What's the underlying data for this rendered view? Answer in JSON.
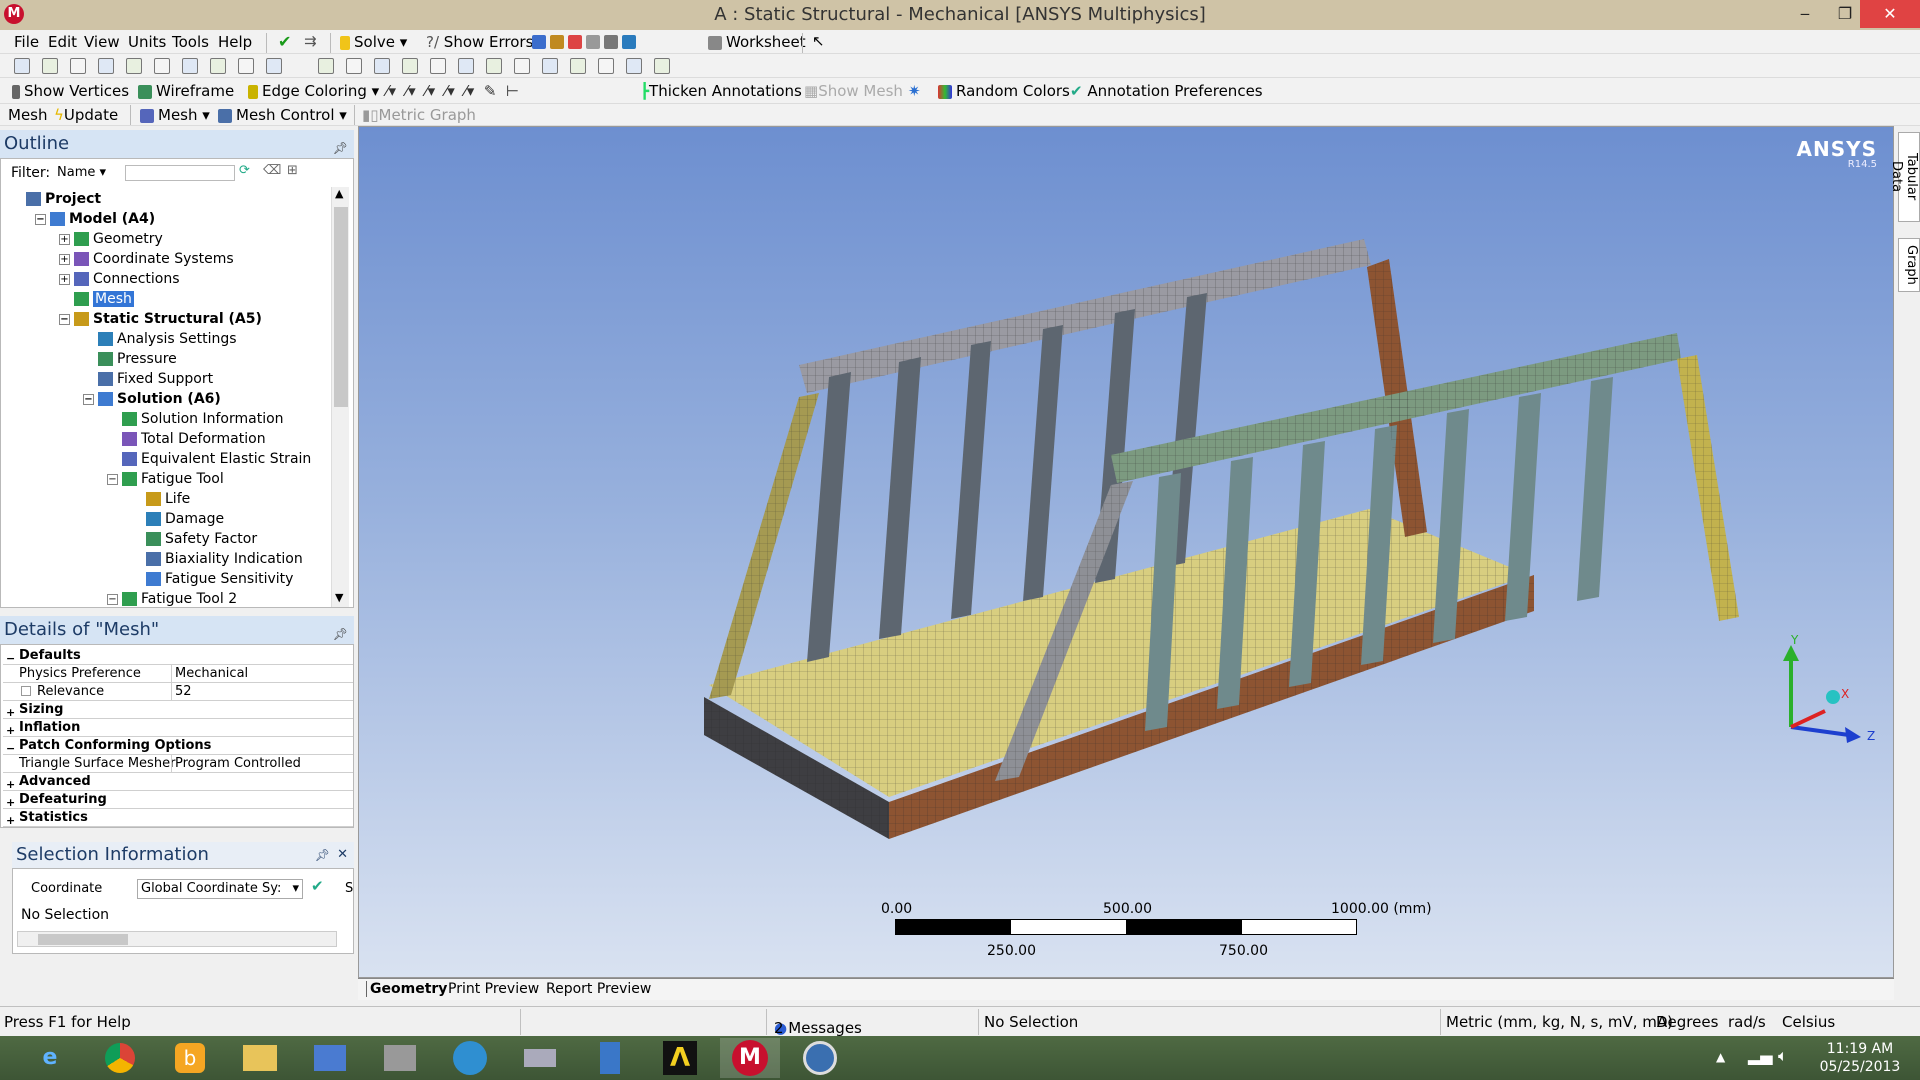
{
  "window": {
    "title": "A : Static Structural - Mechanical [ANSYS Multiphysics]",
    "logo": "M"
  },
  "menu": [
    "File",
    "Edit",
    "View",
    "Units",
    "Tools",
    "Help"
  ],
  "toolbar1": {
    "solve": "Solve",
    "show_errors": "Show Errors",
    "worksheet": "Worksheet"
  },
  "toolbar3": {
    "show_vertices": "Show Vertices",
    "wireframe": "Wireframe",
    "edge_coloring": "Edge Coloring",
    "thicken_annotations": "Thicken Annotations",
    "show_mesh": "Show Mesh",
    "random_colors": "Random Colors",
    "annotation_preferences": "Annotation Preferences"
  },
  "toolbar4": {
    "mesh_label": "Mesh",
    "update": "Update",
    "mesh": "Mesh",
    "mesh_control": "Mesh Control",
    "metric_graph": "Metric Graph"
  },
  "outline": {
    "title": "Outline",
    "filter_label": "Filter:",
    "filter_value": "Name",
    "tree": [
      {
        "label": "Project",
        "indent": 0,
        "bold": true,
        "exp": ""
      },
      {
        "label": "Model (A4)",
        "indent": 1,
        "bold": true,
        "exp": "−"
      },
      {
        "label": "Geometry",
        "indent": 2,
        "bold": false,
        "exp": "+"
      },
      {
        "label": "Coordinate Systems",
        "indent": 2,
        "bold": false,
        "exp": "+"
      },
      {
        "label": "Connections",
        "indent": 2,
        "bold": false,
        "exp": "+"
      },
      {
        "label": "Mesh",
        "indent": 2,
        "bold": false,
        "exp": "",
        "selected": true
      },
      {
        "label": "Static Structural (A5)",
        "indent": 2,
        "bold": true,
        "exp": "−"
      },
      {
        "label": "Analysis Settings",
        "indent": 3,
        "bold": false,
        "exp": ""
      },
      {
        "label": "Pressure",
        "indent": 3,
        "bold": false,
        "exp": ""
      },
      {
        "label": "Fixed Support",
        "indent": 3,
        "bold": false,
        "exp": ""
      },
      {
        "label": "Solution (A6)",
        "indent": 3,
        "bold": true,
        "exp": "−"
      },
      {
        "label": "Solution Information",
        "indent": 4,
        "bold": false,
        "exp": ""
      },
      {
        "label": "Total Deformation",
        "indent": 4,
        "bold": false,
        "exp": ""
      },
      {
        "label": "Equivalent Elastic Strain",
        "indent": 4,
        "bold": false,
        "exp": ""
      },
      {
        "label": "Fatigue Tool",
        "indent": 4,
        "bold": false,
        "exp": "−"
      },
      {
        "label": "Life",
        "indent": 5,
        "bold": false,
        "exp": ""
      },
      {
        "label": "Damage",
        "indent": 5,
        "bold": false,
        "exp": ""
      },
      {
        "label": "Safety Factor",
        "indent": 5,
        "bold": false,
        "exp": ""
      },
      {
        "label": "Biaxiality Indication",
        "indent": 5,
        "bold": false,
        "exp": ""
      },
      {
        "label": "Fatigue Sensitivity",
        "indent": 5,
        "bold": false,
        "exp": ""
      },
      {
        "label": "Fatigue Tool 2",
        "indent": 4,
        "bold": false,
        "exp": "−"
      }
    ]
  },
  "details": {
    "title": "Details of \"Mesh\"",
    "rows": [
      {
        "type": "group",
        "label": "Defaults",
        "sign": "−"
      },
      {
        "type": "prop",
        "key": "Physics Preference",
        "value": "Mechanical"
      },
      {
        "type": "prop",
        "key": "Relevance",
        "value": "52",
        "checkbox": true
      },
      {
        "type": "group",
        "label": "Sizing",
        "sign": "+"
      },
      {
        "type": "group",
        "label": "Inflation",
        "sign": "+"
      },
      {
        "type": "group",
        "label": "Patch Conforming Options",
        "sign": "−"
      },
      {
        "type": "prop",
        "key": "Triangle Surface Mesher",
        "value": "Program Controlled"
      },
      {
        "type": "group",
        "label": "Advanced",
        "sign": "+"
      },
      {
        "type": "group",
        "label": "Defeaturing",
        "sign": "+"
      },
      {
        "type": "group",
        "label": "Statistics",
        "sign": "+"
      }
    ]
  },
  "selection": {
    "title": "Selection Information",
    "coordinate_label": "Coordinate",
    "coordinate_value": "Global Coordinate Sy:",
    "col_s": "S",
    "no_selection": "No Selection"
  },
  "viewport": {
    "brand": "ANSYS",
    "version": "R14.5",
    "axis": {
      "y": "Y",
      "x": "X",
      "z": "Z"
    },
    "scale": {
      "top": [
        "0.00",
        "500.00",
        "1000.00 (mm)"
      ],
      "bottom": [
        "250.00",
        "750.00"
      ]
    }
  },
  "tabs": [
    "Geometry",
    "Print Preview",
    "Report Preview"
  ],
  "right_tabs": [
    "Tabular Data",
    "Graph"
  ],
  "status": {
    "help": "Press F1 for Help",
    "messages": "2 Messages",
    "selection": "No Selection",
    "units": "Metric (mm, kg, N, s, mV, mA)",
    "angle": "Degrees",
    "rate": "rad/s",
    "temp": "Celsius"
  },
  "clock": {
    "time": "11:19 AM",
    "date": "05/25/2013"
  }
}
